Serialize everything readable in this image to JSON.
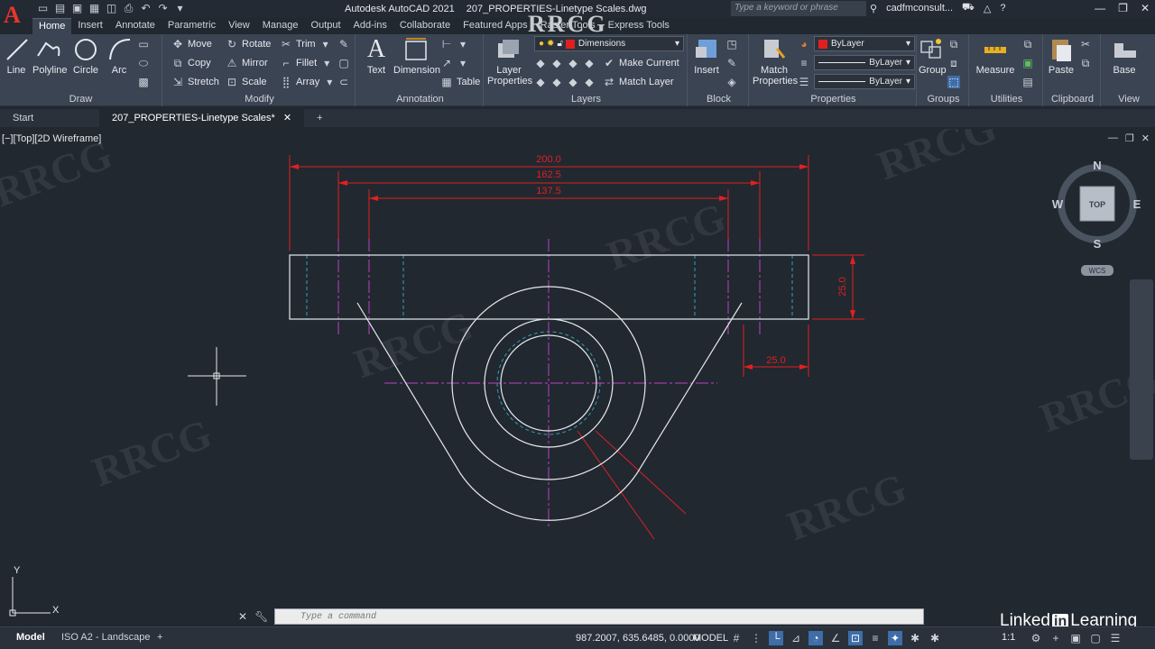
{
  "app": {
    "logo_letter": "A",
    "title": "Autodesk AutoCAD 2021",
    "filename": "207_PROPERTIES-Linetype Scales.dwg",
    "search_placeholder": "Type a keyword or phrase",
    "user": "cadfmconsult...",
    "watermark_banner": "RRCG"
  },
  "ribbon_tabs": [
    "Home",
    "Insert",
    "Annotate",
    "Parametric",
    "View",
    "Manage",
    "Output",
    "Add-ins",
    "Collaborate",
    "Featured Apps",
    "Raster Tools",
    "Express Tools"
  ],
  "ribbon": {
    "draw": {
      "title": "Draw",
      "line": "Line",
      "polyline": "Polyline",
      "circle": "Circle",
      "arc": "Arc"
    },
    "modify": {
      "title": "Modify",
      "move": "Move",
      "rotate": "Rotate",
      "trim": "Trim",
      "copy": "Copy",
      "mirror": "Mirror",
      "fillet": "Fillet",
      "stretch": "Stretch",
      "scale": "Scale",
      "array": "Array"
    },
    "annotation": {
      "title": "Annotation",
      "text": "Text",
      "dimension": "Dimension",
      "table": "Table"
    },
    "layers": {
      "title": "Layers",
      "layer_properties_1": "Layer",
      "layer_properties_2": "Properties",
      "current_layer": "Dimensions",
      "make_current": "Make Current",
      "match_layer": "Match Layer"
    },
    "block": {
      "title": "Block",
      "insert": "Insert"
    },
    "properties": {
      "title": "Properties",
      "match_1": "Match",
      "match_2": "Properties",
      "color": "ByLayer",
      "linetype": "ByLayer",
      "lineweight": "ByLayer"
    },
    "groups": {
      "title": "Groups",
      "group": "Group"
    },
    "utilities": {
      "title": "Utilities",
      "measure": "Measure"
    },
    "clipboard": {
      "title": "Clipboard",
      "paste": "Paste"
    },
    "view": {
      "title": "View",
      "base": "Base"
    }
  },
  "file_tabs": {
    "start": "Start",
    "active": "207_PROPERTIES-Linetype Scales*"
  },
  "viewport": {
    "label": "[−][Top][2D Wireframe]",
    "dims": {
      "d200": "200.0",
      "d162": "162.5",
      "d137": "137.5",
      "d25v": "25.0",
      "d25h": "25.0"
    },
    "viewcube": {
      "n": "N",
      "s": "S",
      "e": "E",
      "w": "W",
      "top": "TOP",
      "wcs": "WCS"
    },
    "ucs": {
      "x": "X",
      "y": "Y"
    }
  },
  "command": {
    "placeholder": "Type a command"
  },
  "status": {
    "model_tab": "Model",
    "layout_tab": "ISO A2 - Landscape",
    "coords": "987.2007, 635.6485, 0.0000",
    "model": "MODEL",
    "scale": "1:1"
  },
  "branding": {
    "linkedin_a": "Linked",
    "linkedin_in": "in",
    "linkedin_b": "Learning"
  },
  "colors": {
    "accent": "#e8362a",
    "dim_red": "#e02020",
    "center_magenta": "#c040c0",
    "geometry": "#e6e9ee"
  }
}
